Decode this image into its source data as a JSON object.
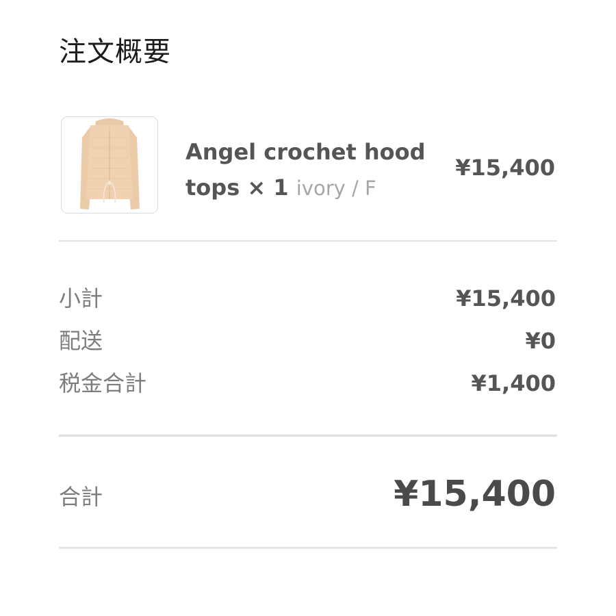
{
  "page": {
    "title": "注文概要"
  },
  "item": {
    "name": "Angel crochet hood tops × 1",
    "variant": "ivory / F",
    "price": "¥15,400",
    "image_icon": "cardigan-product-image"
  },
  "summary": {
    "subtotal_label": "小計",
    "subtotal_value": "¥15,400",
    "shipping_label": "配送",
    "shipping_value": "¥0",
    "tax_label": "税金合計",
    "tax_value": "¥1,400"
  },
  "total": {
    "label": "合計",
    "value": "¥15,400"
  },
  "colors": {
    "text_dark": "#1c1c1c",
    "text_value": "#555555",
    "text_label": "#7d7d7d",
    "text_muted": "#a6a6a6",
    "divider": "#e3e3e3",
    "garment": "#efcfae"
  }
}
